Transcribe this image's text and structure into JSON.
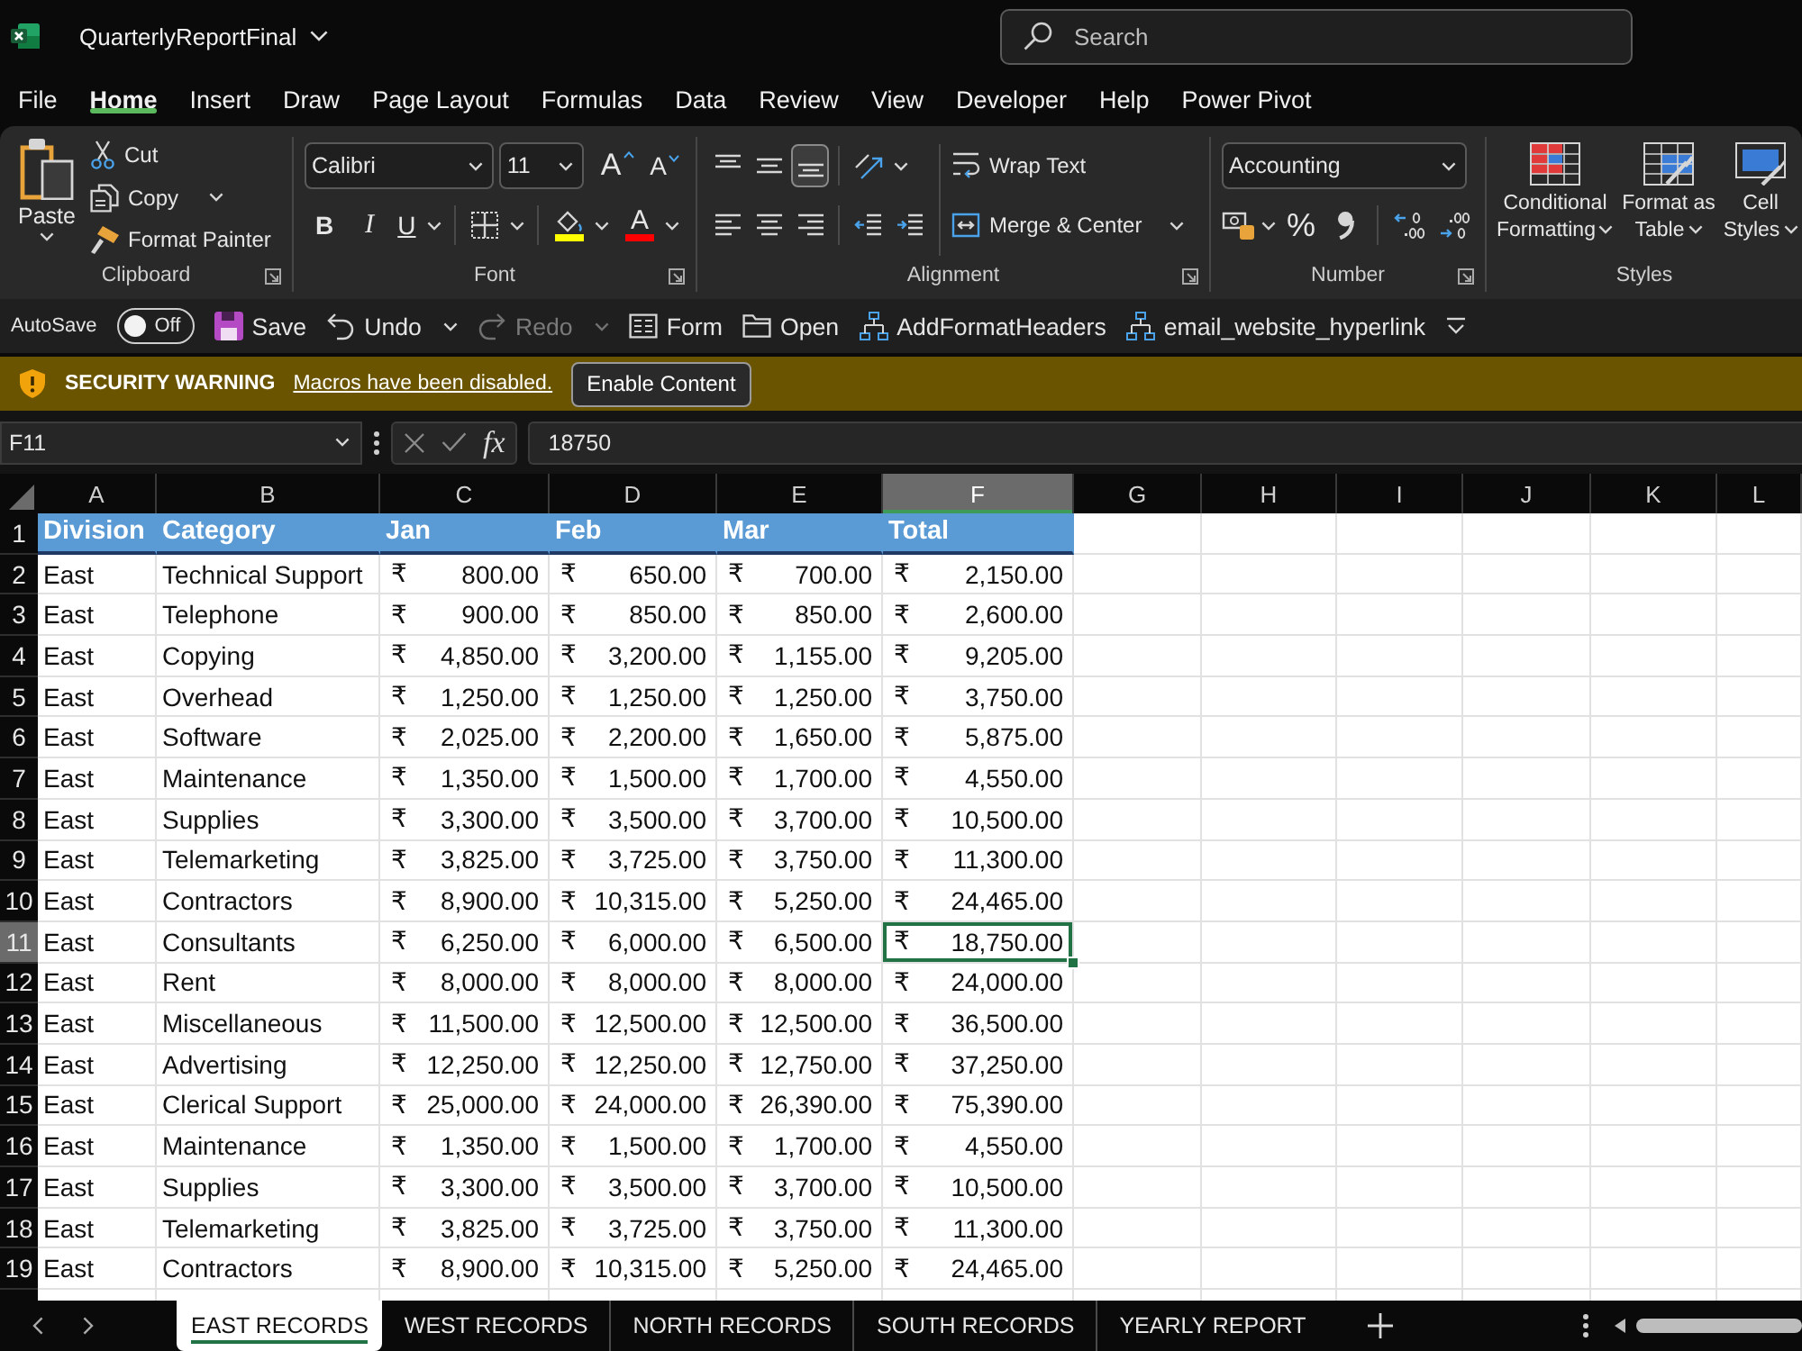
{
  "title_bar": {
    "file_name": "QuarterlyReportFinal",
    "search": {
      "placeholder": "Search"
    }
  },
  "menu_tabs": [
    {
      "label": "File",
      "selected": false
    },
    {
      "label": "Home",
      "selected": true
    },
    {
      "label": "Insert",
      "selected": false
    },
    {
      "label": "Draw",
      "selected": false
    },
    {
      "label": "Page Layout",
      "selected": false
    },
    {
      "label": "Formulas",
      "selected": false
    },
    {
      "label": "Data",
      "selected": false
    },
    {
      "label": "Review",
      "selected": false
    },
    {
      "label": "View",
      "selected": false
    },
    {
      "label": "Developer",
      "selected": false
    },
    {
      "label": "Help",
      "selected": false
    },
    {
      "label": "Power Pivot",
      "selected": false
    }
  ],
  "ribbon": {
    "clipboard": {
      "label": "Clipboard",
      "paste": {
        "label": "Paste",
        "menu": true
      },
      "commands": [
        {
          "kind": "cut",
          "label": "Cut",
          "menu": false
        },
        {
          "kind": "copy",
          "label": "Copy",
          "menu": true
        },
        {
          "kind": "format-painter",
          "label": "Format Painter",
          "menu": false
        }
      ]
    },
    "font": {
      "label": "Font",
      "font_name": "Calibri",
      "font_size": "11",
      "size_buttons": [
        {
          "kind": "grow",
          "glyph": "A"
        },
        {
          "kind": "shrink",
          "glyph": "A"
        }
      ],
      "style_buttons": [
        {
          "kind": "bold",
          "glyph": "B",
          "menu": false
        },
        {
          "kind": "italic",
          "glyph": "I",
          "menu": false
        },
        {
          "kind": "underline",
          "glyph": "U",
          "menu": true
        }
      ],
      "color_buttons": [
        {
          "kind": "fill",
          "color": "#ffff00"
        },
        {
          "kind": "font",
          "glyph": "A",
          "color": "#ff0000"
        }
      ]
    },
    "alignment": {
      "label": "Alignment",
      "vertical": [
        {
          "kind": "top",
          "selected": false
        },
        {
          "kind": "middle",
          "selected": false
        },
        {
          "kind": "bottom",
          "selected": true
        }
      ],
      "horizontal": [
        {
          "kind": "left",
          "selected": false
        },
        {
          "kind": "center",
          "selected": false
        },
        {
          "kind": "right",
          "selected": false
        }
      ],
      "indent": [
        {
          "kind": "decrease"
        },
        {
          "kind": "increase"
        }
      ],
      "commands": [
        {
          "kind": "wrap",
          "label": "Wrap Text",
          "menu": false
        },
        {
          "kind": "merge",
          "label": "Merge & Center",
          "menu": true
        }
      ]
    },
    "number": {
      "label": "Number",
      "format": "Accounting",
      "commands": [
        {
          "kind": "accounting",
          "menu": true
        },
        {
          "kind": "percent",
          "glyph": "%",
          "menu": false
        },
        {
          "kind": "comma",
          "menu": false
        },
        {
          "kind": "increase-decimal",
          "menu": false
        },
        {
          "kind": "decrease-decimal",
          "menu": false
        }
      ]
    },
    "styles": {
      "label": "Styles",
      "commands": [
        {
          "kind": "conditional",
          "label": "Conditional Formatting"
        },
        {
          "kind": "table",
          "label": "Format as Table"
        },
        {
          "kind": "cell",
          "label": "Cell Styles"
        }
      ]
    }
  },
  "quick_access": {
    "autosave": {
      "label": "AutoSave",
      "on": false,
      "state": "Off"
    },
    "commands": [
      {
        "kind": "save",
        "label": "Save",
        "menu": false,
        "disabled": false
      },
      {
        "kind": "undo",
        "label": "Undo",
        "menu": true,
        "disabled": false
      },
      {
        "kind": "redo",
        "label": "Redo",
        "menu": true,
        "disabled": true
      },
      {
        "kind": "form",
        "label": "Form",
        "menu": false,
        "disabled": false
      },
      {
        "kind": "open",
        "label": "Open",
        "menu": false,
        "disabled": false
      },
      {
        "kind": "macro",
        "label": "AddFormatHeaders",
        "menu": false,
        "disabled": false
      },
      {
        "kind": "macro",
        "label": "email_website_hyperlink",
        "menu": false,
        "disabled": false
      }
    ]
  },
  "security_bar": {
    "title": "SECURITY WARNING",
    "message": "Macros have been disabled.",
    "button": "Enable Content"
  },
  "formula_bar": {
    "name_box": "F11",
    "function_glyph": "fx",
    "formula": "18750"
  },
  "sheet": {
    "columns": [
      {
        "letter": "A",
        "selected": false
      },
      {
        "letter": "B",
        "selected": false
      },
      {
        "letter": "C",
        "selected": false
      },
      {
        "letter": "D",
        "selected": false
      },
      {
        "letter": "E",
        "selected": false
      },
      {
        "letter": "F",
        "selected": true
      },
      {
        "letter": "G",
        "selected": false
      },
      {
        "letter": "H",
        "selected": false
      },
      {
        "letter": "I",
        "selected": false
      },
      {
        "letter": "J",
        "selected": false
      },
      {
        "letter": "K",
        "selected": false
      },
      {
        "letter": "L",
        "selected": false
      }
    ],
    "rows": [
      {
        "number": "1",
        "kind": "header",
        "selected": false,
        "cells": [
          "Division",
          "Category",
          "Jan",
          "Feb",
          "Mar",
          "Total"
        ]
      },
      {
        "number": "2",
        "kind": "data",
        "selected": false,
        "cells": [
          "East",
          "Technical Support",
          {
            "symbol": "₹",
            "amount": "800.00"
          },
          {
            "symbol": "₹",
            "amount": "650.00"
          },
          {
            "symbol": "₹",
            "amount": "700.00"
          },
          {
            "symbol": "₹",
            "amount": "2,150.00"
          }
        ]
      },
      {
        "number": "3",
        "kind": "data",
        "selected": false,
        "cells": [
          "East",
          "Telephone",
          {
            "symbol": "₹",
            "amount": "900.00"
          },
          {
            "symbol": "₹",
            "amount": "850.00"
          },
          {
            "symbol": "₹",
            "amount": "850.00"
          },
          {
            "symbol": "₹",
            "amount": "2,600.00"
          }
        ]
      },
      {
        "number": "4",
        "kind": "data",
        "selected": false,
        "cells": [
          "East",
          "Copying",
          {
            "symbol": "₹",
            "amount": "4,850.00"
          },
          {
            "symbol": "₹",
            "amount": "3,200.00"
          },
          {
            "symbol": "₹",
            "amount": "1,155.00"
          },
          {
            "symbol": "₹",
            "amount": "9,205.00"
          }
        ]
      },
      {
        "number": "5",
        "kind": "data",
        "selected": false,
        "cells": [
          "East",
          "Overhead",
          {
            "symbol": "₹",
            "amount": "1,250.00"
          },
          {
            "symbol": "₹",
            "amount": "1,250.00"
          },
          {
            "symbol": "₹",
            "amount": "1,250.00"
          },
          {
            "symbol": "₹",
            "amount": "3,750.00"
          }
        ]
      },
      {
        "number": "6",
        "kind": "data",
        "selected": false,
        "cells": [
          "East",
          "Software",
          {
            "symbol": "₹",
            "amount": "2,025.00"
          },
          {
            "symbol": "₹",
            "amount": "2,200.00"
          },
          {
            "symbol": "₹",
            "amount": "1,650.00"
          },
          {
            "symbol": "₹",
            "amount": "5,875.00"
          }
        ]
      },
      {
        "number": "7",
        "kind": "data",
        "selected": false,
        "cells": [
          "East",
          "Maintenance",
          {
            "symbol": "₹",
            "amount": "1,350.00"
          },
          {
            "symbol": "₹",
            "amount": "1,500.00"
          },
          {
            "symbol": "₹",
            "amount": "1,700.00"
          },
          {
            "symbol": "₹",
            "amount": "4,550.00"
          }
        ]
      },
      {
        "number": "8",
        "kind": "data",
        "selected": false,
        "cells": [
          "East",
          "Supplies",
          {
            "symbol": "₹",
            "amount": "3,300.00"
          },
          {
            "symbol": "₹",
            "amount": "3,500.00"
          },
          {
            "symbol": "₹",
            "amount": "3,700.00"
          },
          {
            "symbol": "₹",
            "amount": "10,500.00"
          }
        ]
      },
      {
        "number": "9",
        "kind": "data",
        "selected": false,
        "cells": [
          "East",
          "Telemarketing",
          {
            "symbol": "₹",
            "amount": "3,825.00"
          },
          {
            "symbol": "₹",
            "amount": "3,725.00"
          },
          {
            "symbol": "₹",
            "amount": "3,750.00"
          },
          {
            "symbol": "₹",
            "amount": "11,300.00"
          }
        ]
      },
      {
        "number": "10",
        "kind": "data",
        "selected": false,
        "cells": [
          "East",
          "Contractors",
          {
            "symbol": "₹",
            "amount": "8,900.00"
          },
          {
            "symbol": "₹",
            "amount": "10,315.00"
          },
          {
            "symbol": "₹",
            "amount": "5,250.00"
          },
          {
            "symbol": "₹",
            "amount": "24,465.00"
          }
        ]
      },
      {
        "number": "11",
        "kind": "data",
        "selected": true,
        "cells": [
          "East",
          "Consultants",
          {
            "symbol": "₹",
            "amount": "6,250.00"
          },
          {
            "symbol": "₹",
            "amount": "6,000.00"
          },
          {
            "symbol": "₹",
            "amount": "6,500.00"
          },
          {
            "symbol": "₹",
            "amount": "18,750.00"
          }
        ]
      },
      {
        "number": "12",
        "kind": "data",
        "selected": false,
        "cells": [
          "East",
          "Rent",
          {
            "symbol": "₹",
            "amount": "8,000.00"
          },
          {
            "symbol": "₹",
            "amount": "8,000.00"
          },
          {
            "symbol": "₹",
            "amount": "8,000.00"
          },
          {
            "symbol": "₹",
            "amount": "24,000.00"
          }
        ]
      },
      {
        "number": "13",
        "kind": "data",
        "selected": false,
        "cells": [
          "East",
          "Miscellaneous",
          {
            "symbol": "₹",
            "amount": "11,500.00"
          },
          {
            "symbol": "₹",
            "amount": "12,500.00"
          },
          {
            "symbol": "₹",
            "amount": "12,500.00"
          },
          {
            "symbol": "₹",
            "amount": "36,500.00"
          }
        ]
      },
      {
        "number": "14",
        "kind": "data",
        "selected": false,
        "cells": [
          "East",
          "Advertising",
          {
            "symbol": "₹",
            "amount": "12,250.00"
          },
          {
            "symbol": "₹",
            "amount": "12,250.00"
          },
          {
            "symbol": "₹",
            "amount": "12,750.00"
          },
          {
            "symbol": "₹",
            "amount": "37,250.00"
          }
        ]
      },
      {
        "number": "15",
        "kind": "data",
        "selected": false,
        "cells": [
          "East",
          "Clerical Support",
          {
            "symbol": "₹",
            "amount": "25,000.00"
          },
          {
            "symbol": "₹",
            "amount": "24,000.00"
          },
          {
            "symbol": "₹",
            "amount": "26,390.00"
          },
          {
            "symbol": "₹",
            "amount": "75,390.00"
          }
        ]
      },
      {
        "number": "16",
        "kind": "data",
        "selected": false,
        "cells": [
          "East",
          "Maintenance",
          {
            "symbol": "₹",
            "amount": "1,350.00"
          },
          {
            "symbol": "₹",
            "amount": "1,500.00"
          },
          {
            "symbol": "₹",
            "amount": "1,700.00"
          },
          {
            "symbol": "₹",
            "amount": "4,550.00"
          }
        ]
      },
      {
        "number": "17",
        "kind": "data",
        "selected": false,
        "cells": [
          "East",
          "Supplies",
          {
            "symbol": "₹",
            "amount": "3,300.00"
          },
          {
            "symbol": "₹",
            "amount": "3,500.00"
          },
          {
            "symbol": "₹",
            "amount": "3,700.00"
          },
          {
            "symbol": "₹",
            "amount": "10,500.00"
          }
        ]
      },
      {
        "number": "18",
        "kind": "data",
        "selected": false,
        "cells": [
          "East",
          "Telemarketing",
          {
            "symbol": "₹",
            "amount": "3,825.00"
          },
          {
            "symbol": "₹",
            "amount": "3,725.00"
          },
          {
            "symbol": "₹",
            "amount": "3,750.00"
          },
          {
            "symbol": "₹",
            "amount": "11,300.00"
          }
        ]
      },
      {
        "number": "19",
        "kind": "data",
        "selected": false,
        "cells": [
          "East",
          "Contractors",
          {
            "symbol": "₹",
            "amount": "8,900.00"
          },
          {
            "symbol": "₹",
            "amount": "10,315.00"
          },
          {
            "symbol": "₹",
            "amount": "5,250.00"
          },
          {
            "symbol": "₹",
            "amount": "24,465.00"
          }
        ]
      }
    ]
  },
  "sheet_tabs": [
    {
      "label": "EAST RECORDS",
      "selected": true
    },
    {
      "label": "WEST RECORDS",
      "selected": false
    },
    {
      "label": "NORTH RECORDS",
      "selected": false
    },
    {
      "label": "SOUTH RECORDS",
      "selected": false
    },
    {
      "label": "YEARLY REPORT",
      "selected": false
    }
  ]
}
